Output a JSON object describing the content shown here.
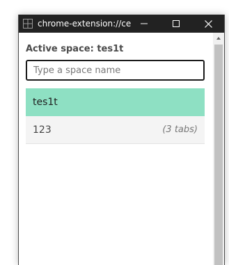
{
  "window": {
    "title": "chrome-extension://ce…",
    "icons": {
      "app": "app-grid-icon",
      "minimize": "minimize-icon",
      "maximize": "maximize-icon",
      "close": "close-icon"
    }
  },
  "header": {
    "active_space_label": "Active space: tes1t"
  },
  "search": {
    "placeholder": "Type a space name",
    "value": ""
  },
  "spaces": [
    {
      "name": "tes1t",
      "tabs": "",
      "active": true
    },
    {
      "name": "123",
      "tabs": "(3 tabs)",
      "active": false
    }
  ],
  "colors": {
    "titlebar": "#222222",
    "active_space": "#8ee0c3",
    "inactive_space": "#f4f4f4"
  }
}
